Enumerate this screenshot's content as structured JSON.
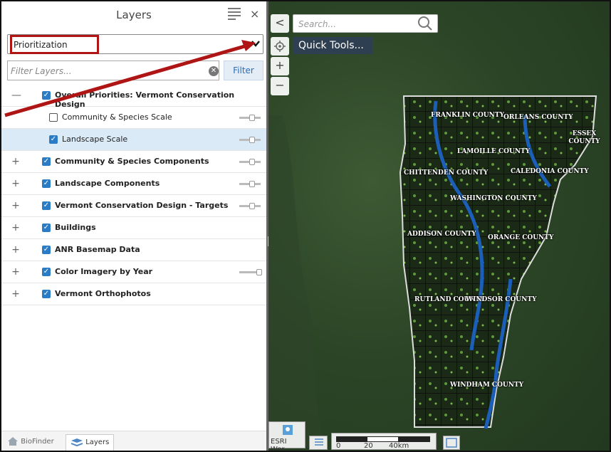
{
  "panel": {
    "title": "Layers",
    "close_glyph": "×",
    "dropdown_value": "Prioritization",
    "dropdown_chevron": "❯",
    "filter_placeholder": "Filter Layers...",
    "filter_clear": "✕",
    "filter_button": "Filter"
  },
  "layers": [
    {
      "label": "Overall Priorities: Vermont Conservation Design",
      "expander": "—",
      "checked": true,
      "bold": true,
      "slider": false,
      "indent": false
    },
    {
      "label": "Community & Species Scale",
      "expander": "",
      "checked": false,
      "bold": false,
      "slider": true,
      "indent": true
    },
    {
      "label": "Landscape Scale",
      "expander": "",
      "checked": true,
      "bold": false,
      "slider": true,
      "indent": true,
      "selected": true
    },
    {
      "label": "Community & Species Components",
      "expander": "+",
      "checked": true,
      "bold": true,
      "slider": true,
      "indent": false
    },
    {
      "label": "Landscape Components",
      "expander": "+",
      "checked": true,
      "bold": true,
      "slider": true,
      "indent": false
    },
    {
      "label": "Vermont Conservation Design - Targets",
      "expander": "+",
      "checked": true,
      "bold": true,
      "slider": true,
      "indent": false
    },
    {
      "label": "Buildings",
      "expander": "+",
      "checked": true,
      "bold": true,
      "slider": false,
      "indent": false
    },
    {
      "label": "ANR Basemap Data",
      "expander": "+",
      "checked": true,
      "bold": true,
      "slider": false,
      "indent": false
    },
    {
      "label": "Color Imagery by Year",
      "expander": "+",
      "checked": true,
      "bold": true,
      "slider": true,
      "slider_full": true,
      "indent": false
    },
    {
      "label": "Vermont Orthophotos",
      "expander": "+",
      "checked": true,
      "bold": true,
      "slider": false,
      "indent": false
    }
  ],
  "footer": {
    "tab_biofinder": "BioFinder",
    "tab_layers": "Layers"
  },
  "map": {
    "collapse_glyph": "<",
    "search_placeholder": "Search...",
    "quick_tools": "Quick Tools...",
    "zoom_in": "+",
    "zoom_out": "−",
    "basemap_label": "ESRI Wor...",
    "scale_labels": [
      "0",
      "20",
      "40km"
    ],
    "counties": [
      "FRANKLIN COUNTY",
      "ORLEANS COUNTY",
      "ESSEX COUNTY",
      "LAMOILLE COUNTY",
      "CHITTENDEN COUNTY",
      "CALEDONIA COUNTY",
      "WASHINGTON COUNTY",
      "ADDISON COUNTY",
      "ORANGE COUNTY",
      "RUTLAND COUNTY",
      "WINDSOR COUNTY",
      "WINDHAM COUNTY"
    ]
  },
  "colors": {
    "accent": "#2a7cc7",
    "highlight_box": "#b01515",
    "quick_tools_bg": "#2f3f52",
    "river": "#1c5fb8"
  }
}
